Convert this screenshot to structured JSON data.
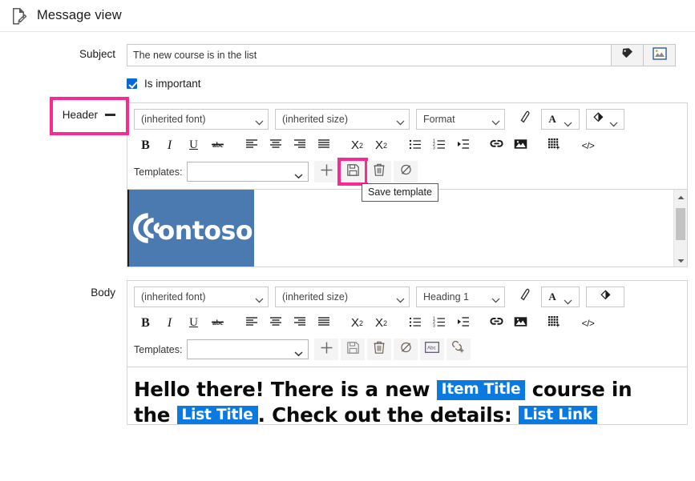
{
  "page": {
    "title": "Message view",
    "doc_icon": "document-edit-icon"
  },
  "subject": {
    "label": "Subject",
    "value": "The new course is in the list",
    "placeholder": "",
    "buttons": [
      {
        "name": "insert-token-button",
        "icon": "tag-icon"
      },
      {
        "name": "insert-placeholder-button",
        "icon": "picture-placeholder-icon"
      }
    ]
  },
  "important": {
    "label": "Is important",
    "checked": true
  },
  "header_section": {
    "label": "Header",
    "collapse_icon": "minus-icon",
    "highlighted": true,
    "highlight_color": "#fb2a91",
    "toolbar": {
      "font": "(inherited font)",
      "size": "(inherited size)",
      "format": "Format",
      "pen_icon": "highlighter-pen-icon",
      "text_color_label": "A",
      "fill_color_icon": "paint-bucket-icon"
    },
    "format_buttons": [
      {
        "name": "bold-button",
        "glyph": "B"
      },
      {
        "name": "italic-button",
        "glyph": "I"
      },
      {
        "name": "underline-button",
        "glyph": "U"
      },
      {
        "name": "strikethrough-button",
        "glyph": "abc"
      },
      {
        "name": "align-left-button",
        "glyph": "align-left-icon"
      },
      {
        "name": "align-center-button",
        "glyph": "align-center-icon"
      },
      {
        "name": "align-right-button",
        "glyph": "align-right-icon"
      },
      {
        "name": "align-justify-button",
        "glyph": "align-justify-icon"
      },
      {
        "name": "subscript-button",
        "glyph": "X2"
      },
      {
        "name": "superscript-button",
        "glyph": "X2"
      },
      {
        "name": "bulleted-list-button",
        "glyph": "bullet-list-icon"
      },
      {
        "name": "numbered-list-button",
        "glyph": "numbered-list-icon"
      },
      {
        "name": "indent-button",
        "glyph": "indent-icon"
      },
      {
        "name": "insert-link-button",
        "glyph": "link-icon"
      },
      {
        "name": "insert-image-button",
        "glyph": "image-icon"
      },
      {
        "name": "insert-table-button",
        "glyph": "table-icon"
      },
      {
        "name": "source-code-button",
        "glyph": "code-icon"
      }
    ],
    "templates": {
      "label": "Templates:",
      "value": "",
      "buttons": [
        {
          "name": "add-template-button",
          "icon": "plus-icon"
        },
        {
          "name": "save-template-button",
          "icon": "save-icon",
          "highlighted": true
        },
        {
          "name": "delete-template-button",
          "icon": "trash-icon"
        },
        {
          "name": "clear-formatting-button",
          "icon": "eraser-icon"
        }
      ]
    },
    "tooltip": "Save template",
    "content": {
      "logo_text": "Contoso",
      "logo_bg": "#4a7ab0"
    },
    "scrollbar": {
      "up": "caret-up-icon",
      "down": "caret-down-icon"
    }
  },
  "body_section": {
    "label": "Body",
    "toolbar": {
      "font": "(inherited font)",
      "size": "(inherited size)",
      "format": "Heading 1",
      "pen_icon": "highlighter-pen-icon",
      "text_color_label": "A",
      "fill_color_icon": "paint-bucket-icon"
    },
    "format_buttons": [
      {
        "name": "bold-button",
        "glyph": "B"
      },
      {
        "name": "italic-button",
        "glyph": "I"
      },
      {
        "name": "underline-button",
        "glyph": "U"
      },
      {
        "name": "strikethrough-button",
        "glyph": "abc"
      },
      {
        "name": "align-left-button",
        "glyph": "align-left-icon"
      },
      {
        "name": "align-center-button",
        "glyph": "align-center-icon"
      },
      {
        "name": "align-right-button",
        "glyph": "align-right-icon"
      },
      {
        "name": "align-justify-button",
        "glyph": "align-justify-icon"
      },
      {
        "name": "subscript-button",
        "glyph": "X2"
      },
      {
        "name": "superscript-button",
        "glyph": "X2"
      },
      {
        "name": "bulleted-list-button",
        "glyph": "bullet-list-icon"
      },
      {
        "name": "numbered-list-button",
        "glyph": "numbered-list-icon"
      },
      {
        "name": "indent-button",
        "glyph": "indent-icon"
      },
      {
        "name": "insert-link-button",
        "glyph": "link-icon"
      },
      {
        "name": "insert-image-button",
        "glyph": "image-icon"
      },
      {
        "name": "insert-table-button",
        "glyph": "table-icon"
      },
      {
        "name": "source-code-button",
        "glyph": "code-icon"
      }
    ],
    "templates": {
      "label": "Templates:",
      "value": "",
      "buttons": [
        {
          "name": "add-template-button",
          "icon": "plus-icon"
        },
        {
          "name": "save-template-button",
          "icon": "save-icon"
        },
        {
          "name": "delete-template-button",
          "icon": "trash-icon"
        },
        {
          "name": "clear-formatting-button",
          "icon": "eraser-icon"
        },
        {
          "name": "insert-text-token-button",
          "icon": "abc-box-icon"
        },
        {
          "name": "insert-link-token-button",
          "icon": "link-plus-icon"
        }
      ]
    },
    "content": {
      "line1_part1": "Hello there! There is a new",
      "token1": "Item Title",
      "line1_part2": "course in",
      "line2_part1": "the",
      "token2": "List Title",
      "line2_part2": ". Check out the details:",
      "token3": "List Link",
      "token_color": "#0a7ae0"
    }
  }
}
